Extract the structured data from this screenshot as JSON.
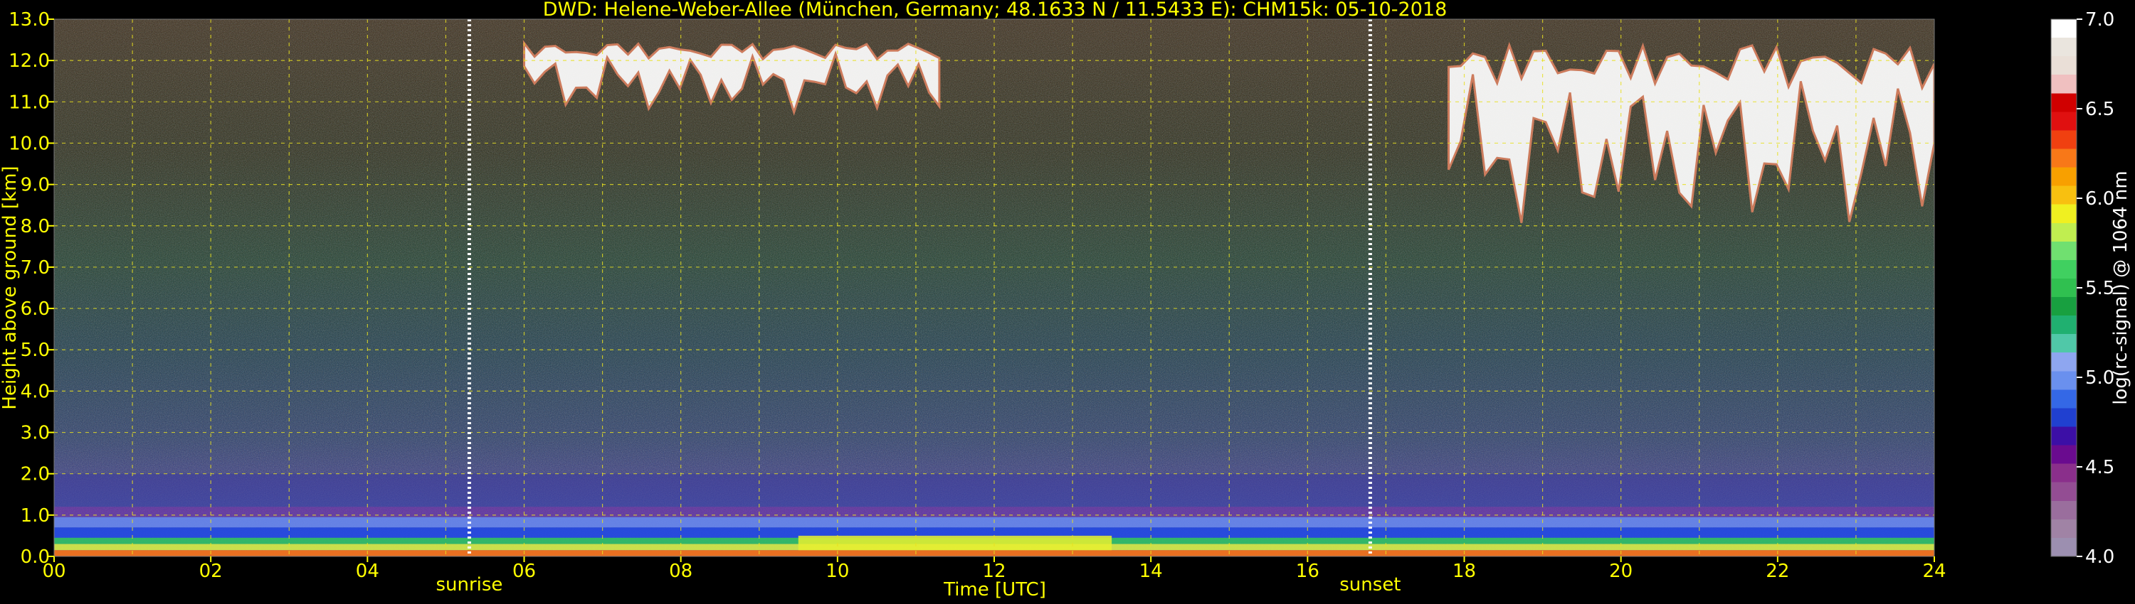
{
  "chart_data": {
    "type": "heatmap",
    "title": "DWD: Helene-Weber-Allee (München, Germany; 48.1633 N / 11.5433 E):    CHM15k: 05-10-2018",
    "xlabel": "Time [UTC]",
    "ylabel": "Height above ground [km]",
    "xlim": [
      0,
      24
    ],
    "ylim": [
      0,
      13
    ],
    "x_ticks": [
      "00",
      "02",
      "04",
      "06",
      "08",
      "10",
      "12",
      "14",
      "16",
      "18",
      "20",
      "22",
      "24"
    ],
    "y_ticks": [
      "0.0",
      "1.0",
      "2.0",
      "3.0",
      "4.0",
      "5.0",
      "6.0",
      "7.0",
      "8.0",
      "9.0",
      "10.0",
      "11.0",
      "12.0",
      "13.0"
    ],
    "grid": true,
    "annotations": [
      {
        "label": "sunrise",
        "x": 5.3
      },
      {
        "label": "sunset",
        "x": 16.8
      }
    ],
    "colorbar": {
      "label": "log(rc-signal) @ 1064 nm",
      "range": [
        4.0,
        7.0
      ],
      "ticks": [
        "4.0",
        "4.5",
        "5.0",
        "5.5",
        "6.0",
        "6.5",
        "7.0"
      ],
      "colors": [
        "#9c8fb0",
        "#a083a5",
        "#9a6e9d",
        "#934d93",
        "#8a2f8b",
        "#6a0b8f",
        "#3c0fa6",
        "#2040d0",
        "#3468e6",
        "#6a90ee",
        "#8ea6f0",
        "#50c8a8",
        "#20b070",
        "#18a040",
        "#30c050",
        "#40d060",
        "#70e070",
        "#c0ee50",
        "#f0f020",
        "#f8c010",
        "#f8a000",
        "#f87818",
        "#f04010",
        "#e01010",
        "#d00000",
        "#f0c0c0",
        "#eadfd7",
        "#eae5de",
        "#ffffff"
      ]
    },
    "cloud_layers": [
      {
        "name": "upper cloud",
        "x_range": [
          6.0,
          11.3
        ],
        "height_range": [
          10.9,
          12.5
        ]
      },
      {
        "name": "upper cloud",
        "x_range": [
          17.8,
          24.0
        ],
        "height_range": [
          8.3,
          12.6
        ]
      }
    ],
    "boundary_layer": {
      "height_range": [
        0.0,
        2.0
      ]
    }
  }
}
